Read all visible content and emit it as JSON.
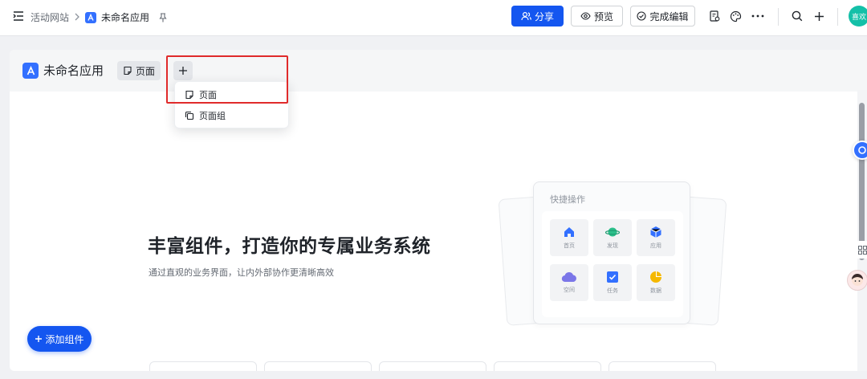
{
  "topbar": {
    "breadcrumb_site": "活动网站",
    "breadcrumb_app": "未命名应用",
    "share_label": "分享",
    "preview_label": "预览",
    "finish_label": "完成编辑",
    "avatar_text": "喜欢"
  },
  "app": {
    "title": "未命名应用",
    "tab_label": "页面"
  },
  "menu": {
    "items": [
      {
        "label": "页面",
        "icon": "page-icon"
      },
      {
        "label": "页面组",
        "icon": "copy-icon"
      }
    ]
  },
  "hero": {
    "title": "丰富组件，打造你的专属业务系统",
    "subtitle": "通过直观的业务界面，让内外部协作更清晰高效",
    "add_button_label": "添加组件"
  },
  "illustration": {
    "title": "快捷操作",
    "tiles": [
      {
        "label": "首页",
        "icon": "home-icon",
        "color": "#3370ff"
      },
      {
        "label": "发现",
        "icon": "planet-icon",
        "color": "#2bbf8a"
      },
      {
        "label": "应用",
        "icon": "cube-icon",
        "color": "#3370ff"
      },
      {
        "label": "空间",
        "icon": "cloud-icon",
        "color": "#7b76e8"
      },
      {
        "label": "任务",
        "icon": "checkbox-icon",
        "color": "#3370ff"
      },
      {
        "label": "数据",
        "icon": "pie-chart-icon",
        "color": "#f5b800"
      }
    ]
  },
  "colors": {
    "primary": "#1456f0",
    "highlight": "#e02b2b"
  }
}
